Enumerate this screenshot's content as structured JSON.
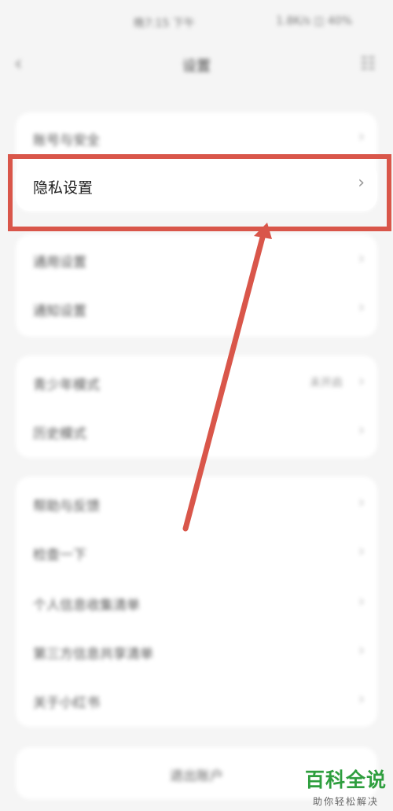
{
  "status_bar": {
    "left_text": "晚7:15 下午",
    "right_text": "1.8K/s ◫ 40%"
  },
  "nav": {
    "back_icon": "‹",
    "title": "设置",
    "menu_icon": "☷"
  },
  "group1": {
    "items": [
      {
        "label": "账号与安全"
      },
      {
        "label": "隐私设置"
      }
    ]
  },
  "group2": {
    "items": [
      {
        "label": "通用设置"
      },
      {
        "label": "通知设置"
      }
    ]
  },
  "group3": {
    "items": [
      {
        "label": "青少年模式",
        "value": "未开启"
      },
      {
        "label": "历史模式"
      }
    ]
  },
  "group4": {
    "items": [
      {
        "label": "帮助与反馈"
      },
      {
        "label": "检查一下"
      },
      {
        "label": "个人信息收集清单"
      },
      {
        "label": "第三方信息共享清单"
      },
      {
        "label": "关于小红书"
      }
    ]
  },
  "logout": {
    "label": "退出账户"
  },
  "chevron": "›",
  "colors": {
    "highlight": "#d9564a",
    "watermark": "#2e9e3e"
  },
  "watermark": {
    "title": "百科全说",
    "subtitle": "助你轻松解决"
  }
}
